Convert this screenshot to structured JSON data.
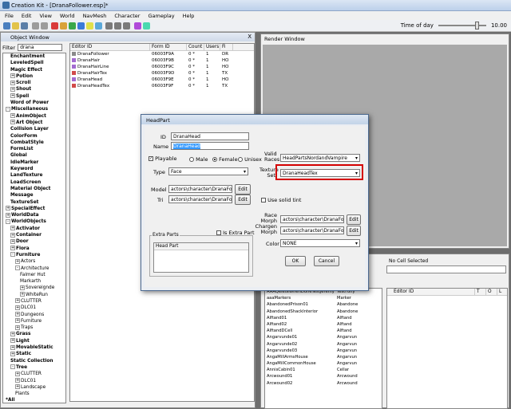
{
  "window": {
    "title": "Creation Kit - [DranaFollower.esp]*"
  },
  "menu": [
    "File",
    "Edit",
    "View",
    "World",
    "NavMesh",
    "Character",
    "Gameplay",
    "Help"
  ],
  "time_of_day": {
    "label": "Time of day",
    "value": "10.00"
  },
  "object_window": {
    "title": "Object Window",
    "close_label": "X",
    "filter_label": "Filter",
    "filter_value": "drana",
    "tree": [
      {
        "label": "Enchantment",
        "indent": 3
      },
      {
        "label": "LeveledSpell",
        "indent": 3
      },
      {
        "label": "Magic Effect",
        "indent": 3
      },
      {
        "label": "Potion",
        "indent": 3,
        "pm": "+"
      },
      {
        "label": "Scroll",
        "indent": 3,
        "pm": "+"
      },
      {
        "label": "Shout",
        "indent": 3,
        "pm": "+"
      },
      {
        "label": "Spell",
        "indent": 3,
        "pm": "+"
      },
      {
        "label": "Word of Power",
        "indent": 3
      },
      {
        "label": "Miscellaneous",
        "indent": 1,
        "pm": "-"
      },
      {
        "label": "AnimObject",
        "indent": 3,
        "pm": "+"
      },
      {
        "label": "Art Object",
        "indent": 3,
        "pm": "+"
      },
      {
        "label": "Collision Layer",
        "indent": 3
      },
      {
        "label": "ColorForm",
        "indent": 3
      },
      {
        "label": "CombatStyle",
        "indent": 3
      },
      {
        "label": "FormList",
        "indent": 3
      },
      {
        "label": "Global",
        "indent": 3
      },
      {
        "label": "IdleMarker",
        "indent": 3
      },
      {
        "label": "Keyword",
        "indent": 3
      },
      {
        "label": "LandTexture",
        "indent": 3
      },
      {
        "label": "LoadScreen",
        "indent": 3
      },
      {
        "label": "Material Object",
        "indent": 3
      },
      {
        "label": "Message",
        "indent": 3
      },
      {
        "label": "TextureSet",
        "indent": 3
      },
      {
        "label": "SpecialEffect",
        "indent": 1,
        "pm": "+"
      },
      {
        "label": "WorldData",
        "indent": 1,
        "pm": "+"
      },
      {
        "label": "WorldObjects",
        "indent": 1,
        "pm": "-"
      },
      {
        "label": "Activator",
        "indent": 3,
        "pm": "+"
      },
      {
        "label": "Container",
        "indent": 3,
        "pm": "+"
      },
      {
        "label": "Door",
        "indent": 3,
        "pm": "+"
      },
      {
        "label": "Flora",
        "indent": 3,
        "pm": "+"
      },
      {
        "label": "Furniture",
        "indent": 3,
        "pm": "-"
      },
      {
        "label": "Actors",
        "indent": 5,
        "pm": "+",
        "n": true
      },
      {
        "label": "Architecture",
        "indent": 5,
        "pm": "-",
        "n": true
      },
      {
        "label": "Falmer Hut",
        "indent": 7,
        "n": true
      },
      {
        "label": "Markarth",
        "indent": 7,
        "n": true
      },
      {
        "label": "Sovereignde",
        "indent": 7,
        "pm": "+",
        "n": true
      },
      {
        "label": "WhiteRun",
        "indent": 7,
        "pm": "+",
        "n": true
      },
      {
        "label": "CLUTTER",
        "indent": 5,
        "pm": "+",
        "n": true
      },
      {
        "label": "DLC01",
        "indent": 5,
        "pm": "+",
        "n": true
      },
      {
        "label": "Dungeons",
        "indent": 5,
        "pm": "+",
        "n": true
      },
      {
        "label": "Furniture",
        "indent": 5,
        "pm": "+",
        "n": true
      },
      {
        "label": "Traps",
        "indent": 5,
        "pm": "+",
        "n": true
      },
      {
        "label": "Grass",
        "indent": 3,
        "pm": "+"
      },
      {
        "label": "Light",
        "indent": 3,
        "pm": "+"
      },
      {
        "label": "MovableStatic",
        "indent": 3,
        "pm": "+"
      },
      {
        "label": "Static",
        "indent": 3,
        "pm": "+"
      },
      {
        "label": "Static Collection",
        "indent": 3
      },
      {
        "label": "Tree",
        "indent": 3,
        "pm": "-"
      },
      {
        "label": "CLUTTER",
        "indent": 5,
        "pm": "+",
        "n": true
      },
      {
        "label": "DLC01",
        "indent": 5,
        "pm": "+",
        "n": true
      },
      {
        "label": "Landscape",
        "indent": 5,
        "pm": "+",
        "n": true
      },
      {
        "label": "Plants",
        "indent": 5,
        "n": true
      },
      {
        "label": "*All",
        "indent": 1
      }
    ],
    "columns": [
      "Editor ID",
      "Form ID",
      "Count",
      "Users",
      "Fi"
    ],
    "rows": [
      {
        "id": "DranaFollower",
        "form": "06003F9A",
        "count": "0 *",
        "users": "1",
        "fi": "DR"
      },
      {
        "id": "DranaHair",
        "form": "06003F9B",
        "count": "0 *",
        "users": "1",
        "fi": "HO"
      },
      {
        "id": "DranaHairLine",
        "form": "06003F9C",
        "count": "0 *",
        "users": "1",
        "fi": "HO"
      },
      {
        "id": "DranaHairTex",
        "form": "06003F9D",
        "count": "0 *",
        "users": "1",
        "fi": "TX"
      },
      {
        "id": "DranaHead",
        "form": "06003F9E",
        "count": "0 *",
        "users": "1",
        "fi": "HO"
      },
      {
        "id": "DranaHeadTex",
        "form": "06003F9F",
        "count": "0 *",
        "users": "1",
        "fi": "TX"
      }
    ]
  },
  "render_window": {
    "title": "Render Window"
  },
  "cell_view": {
    "status": "No Cell Selected",
    "columns": [
      "Editor ID",
      "T",
      "O",
      "L"
    ],
    "rows": [
      {
        "a": "AAAQeleteWhenDoneTestJeremy",
        "b": "TestFony"
      },
      {
        "a": "aaaMarkers",
        "b": "Marker"
      },
      {
        "a": "AbandonedPrison01",
        "b": "Abandone"
      },
      {
        "a": "AbandonedShackInterior",
        "b": "Abandone"
      },
      {
        "a": "Alftand01",
        "b": "Alftand"
      },
      {
        "a": "Alftand02",
        "b": "Alftand"
      },
      {
        "a": "AlftandDCell",
        "b": "Alftand"
      },
      {
        "a": "Angarvunde01",
        "b": "Angarvun"
      },
      {
        "a": "Angarvunde02",
        "b": "Angarvun"
      },
      {
        "a": "Angarvunde03",
        "b": "Angarvun"
      },
      {
        "a": "AngaMillArmsHouse",
        "b": "Angarvun"
      },
      {
        "a": "AngaMillCommonHouse",
        "b": "Angarvun"
      },
      {
        "a": "AnnisCabin01",
        "b": "Cellar"
      },
      {
        "a": "Arcwound01",
        "b": "Arcwound"
      },
      {
        "a": "Arcwound02",
        "b": "Arcwound"
      }
    ]
  },
  "dialog": {
    "title": "HeadPart",
    "id_label": "ID",
    "id_value": "DranaHead",
    "name_label": "Name",
    "name_value": "DranaHead",
    "playable_label": "Playable",
    "male_label": "Male",
    "female_label": "Female",
    "unisex_label": "Unisex",
    "type_label": "Type",
    "type_value": "Face",
    "model_label": "Model",
    "model_value": "actors\\character\\DranaFollower",
    "tri_label": "Tri",
    "tri_value": "actors\\character\\DranaFollower",
    "edit_label": "Edit",
    "extra_part_label": "Is Extra Part",
    "extra_parts_group": "Extra Parts",
    "head_part_col": "Head Part",
    "valid_races_label": "Valid Races",
    "valid_races_value": "HeadPartsNordandVampire",
    "texture_set_label": "Texture Set",
    "texture_set_value": "DranaHeadTex",
    "solid_tint_label": "Use solid tint",
    "race_morph_label": "Race Morph",
    "race_morph_value": "actors\\character\\DranaFollower",
    "chargen_morph_label": "Chargen Morph",
    "chargen_morph_value": "actors\\character\\DranaFollower",
    "color_label": "Color",
    "color_value": "NONE",
    "ok_label": "OK",
    "cancel_label": "Cancel"
  }
}
